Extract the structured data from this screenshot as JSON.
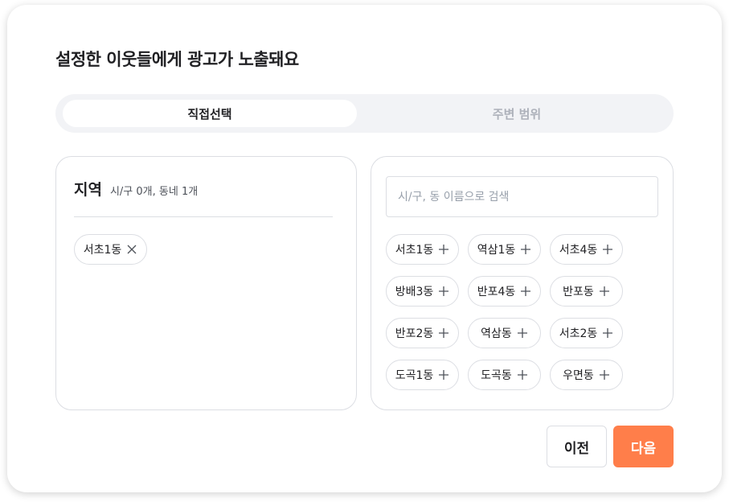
{
  "modal": {
    "title": "설정한 이웃들에게 광고가 노출돼요"
  },
  "tabs": [
    {
      "label": "직접선택",
      "active": true
    },
    {
      "label": "주변 범위",
      "active": false
    }
  ],
  "selected_panel": {
    "title": "지역",
    "count": "시/구 0개, 동네 1개",
    "chips": [
      {
        "label": "서초1동",
        "icon": "close-icon"
      }
    ]
  },
  "search_panel": {
    "placeholder": "시/구, 동 이름으로 검색",
    "value": "",
    "chips": [
      {
        "label": "서초1동",
        "icon": "plus-icon"
      },
      {
        "label": "역삼1동",
        "icon": "plus-icon"
      },
      {
        "label": "서초4동",
        "icon": "plus-icon"
      },
      {
        "label": "방배3동",
        "icon": "plus-icon"
      },
      {
        "label": "반포4동",
        "icon": "plus-icon"
      },
      {
        "label": "반포동",
        "icon": "plus-icon"
      },
      {
        "label": "반포2동",
        "icon": "plus-icon"
      },
      {
        "label": "역삼동",
        "icon": "plus-icon"
      },
      {
        "label": "서초2동",
        "icon": "plus-icon"
      },
      {
        "label": "도곡1동",
        "icon": "plus-icon"
      },
      {
        "label": "도곡동",
        "icon": "plus-icon"
      },
      {
        "label": "우면동",
        "icon": "plus-icon"
      }
    ]
  },
  "footer": {
    "prev_label": "이전",
    "next_label": "다음"
  },
  "colors": {
    "accent": "#ff7e4a",
    "tab_bg": "#f2f3f6",
    "border": "#dcdee3",
    "muted": "#adb1ba"
  }
}
